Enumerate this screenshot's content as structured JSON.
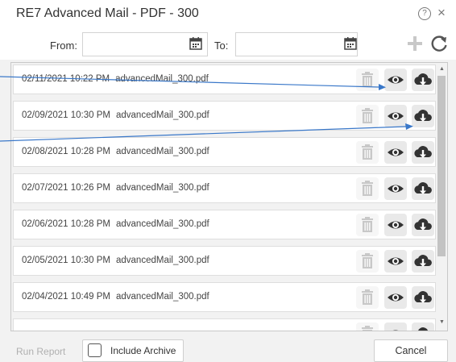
{
  "dialog": {
    "title": "RE7 Advanced Mail - PDF - 300",
    "help_icon": "help-icon",
    "close_icon": "close-icon"
  },
  "filter": {
    "from_label": "From:",
    "from_value": "",
    "to_label": "To:",
    "to_value": "",
    "calendar_icon": "calendar-icon",
    "add_icon": "plus-icon",
    "refresh_icon": "refresh-icon"
  },
  "reports": [
    {
      "date": "02/11/2021 10:22 PM",
      "file": "advancedMail_300.pdf"
    },
    {
      "date": "02/09/2021 10:30 PM",
      "file": "advancedMail_300.pdf"
    },
    {
      "date": "02/08/2021 10:28 PM",
      "file": "advancedMail_300.pdf"
    },
    {
      "date": "02/07/2021 10:26 PM",
      "file": "advancedMail_300.pdf"
    },
    {
      "date": "02/06/2021 10:28 PM",
      "file": "advancedMail_300.pdf"
    },
    {
      "date": "02/05/2021 10:30 PM",
      "file": "advancedMail_300.pdf"
    },
    {
      "date": "02/04/2021 10:49 PM",
      "file": "advancedMail_300.pdf"
    },
    {
      "date": "",
      "file": ""
    }
  ],
  "row_actions": {
    "delete_icon": "trash-icon",
    "view_icon": "eye-icon",
    "download_icon": "cloud-download-icon"
  },
  "footer": {
    "run_report_label": "Run Report",
    "include_archive_label": "Include Archive",
    "include_archive_checked": false,
    "cancel_label": "Cancel"
  },
  "colors": {
    "annotation_arrow": "#3a78c9",
    "icon_dark": "#333333",
    "icon_disabled": "#c8c8c8"
  }
}
